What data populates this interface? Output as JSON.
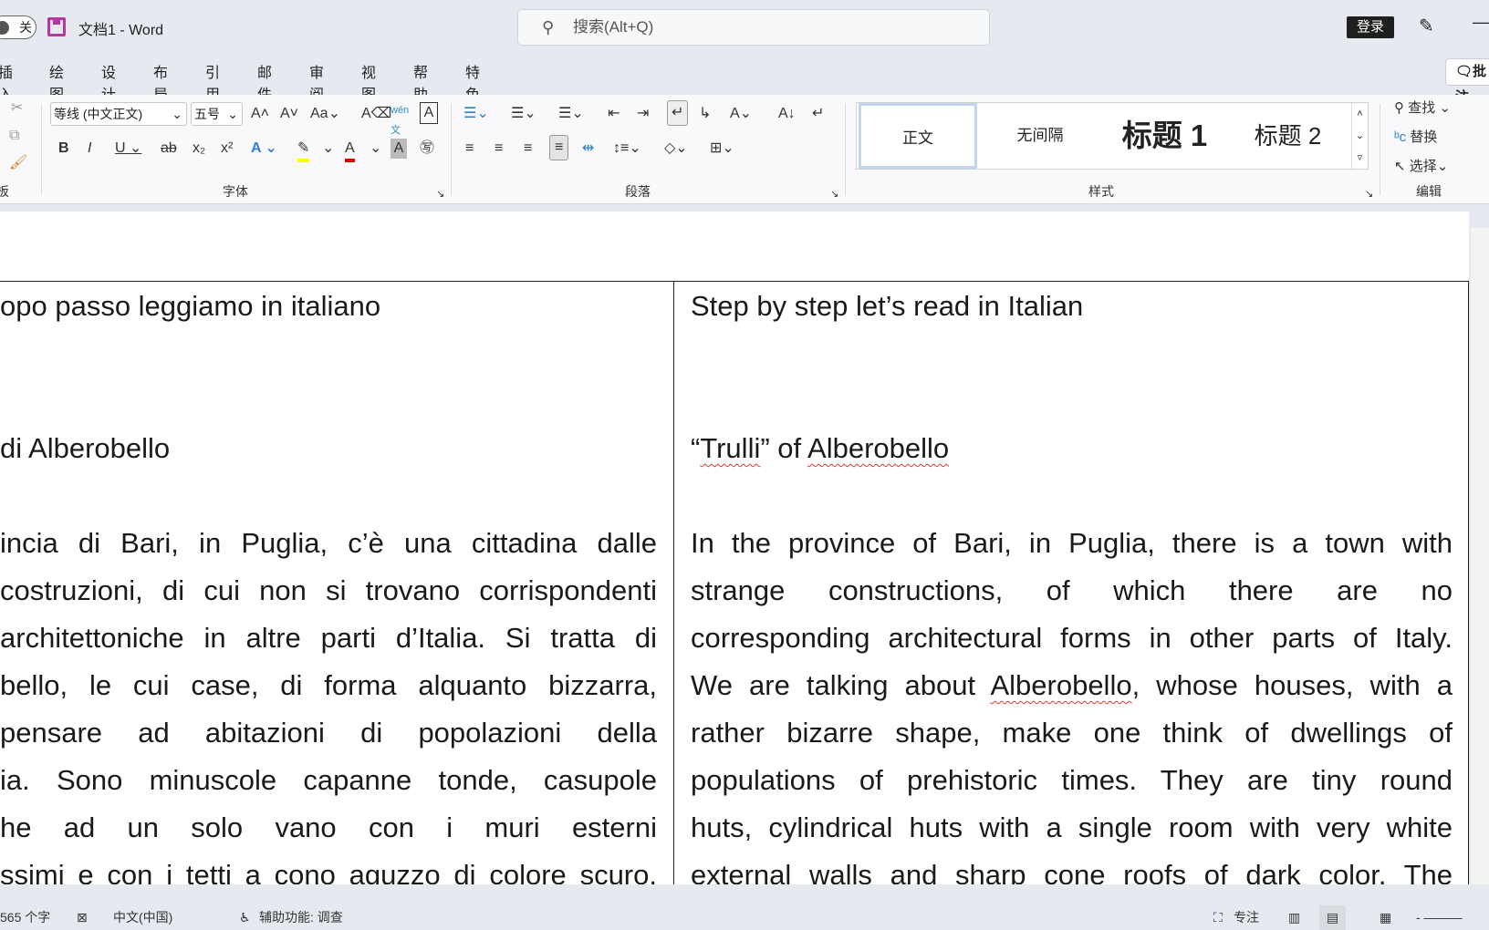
{
  "titlebar": {
    "autosave_state": "关",
    "doc_title": "文档1 - Word",
    "search_placeholder": "搜索(Alt+Q)",
    "login": "登录"
  },
  "menu": [
    "插入",
    "绘图",
    "设计",
    "布局",
    "引用",
    "邮件",
    "审阅",
    "视图",
    "帮助",
    "特色功能"
  ],
  "comment_button": "批注",
  "ribbon": {
    "font_name": "等线 (中文正文)",
    "font_size": "五号",
    "groups": {
      "clipboard": "板",
      "font": "字体",
      "paragraph": "段落",
      "styles": "样式",
      "editing": "编辑"
    },
    "styles": [
      "正文",
      "无间隔",
      "标题 1",
      "标题 2"
    ],
    "editing": {
      "find": "查找",
      "replace": "替换",
      "select": "选择"
    },
    "highlight_color": "#ffff00",
    "font_color": "#e00000"
  },
  "document": {
    "left": [
      "opo passo leggiamo in italiano",
      "di Alberobello",
      "incia di Bari, in Puglia, c’è una cittadina dalle",
      "costruzioni, di cui non si trovano corrispondenti",
      "architettoniche in altre parti d’Italia. Si tratta di",
      "bello, le cui case, di forma alquanto bizzarra,",
      "pensare ad abitazioni di popolazioni della",
      "ia. Sono minuscole capanne tonde, casupole",
      "he ad un solo vano con i muri esterni",
      "ssimi e con i tetti a cono aguzzo di colore scuro."
    ],
    "right_heading": "Step by step let’s read in Italian",
    "right_title": {
      "q1": "“",
      "trulli": "Trulli",
      "mid": "” of ",
      "alberobello": "Alberobello"
    },
    "right": [
      "In the province of Bari, in Puglia, there is a town with",
      "strange constructions, of which there are no",
      "corresponding architectural forms in other parts of Italy."
    ],
    "right_l4": {
      "a": "We are talking about ",
      "b": "Alberobello",
      ", c": "",
      "c": ", whose houses, with a"
    },
    "right_rest": [
      "rather bizarre shape, make one think of dwellings of",
      "populations of prehistoric times. They are tiny round",
      "huts, cylindrical huts with a single room with very white",
      "external walls and sharp cone roofs of dark color. The"
    ]
  },
  "statusbar": {
    "word_count": "565 个字",
    "language": "中文(中国)",
    "accessibility": "辅助功能: 调查",
    "focus": "专注"
  }
}
